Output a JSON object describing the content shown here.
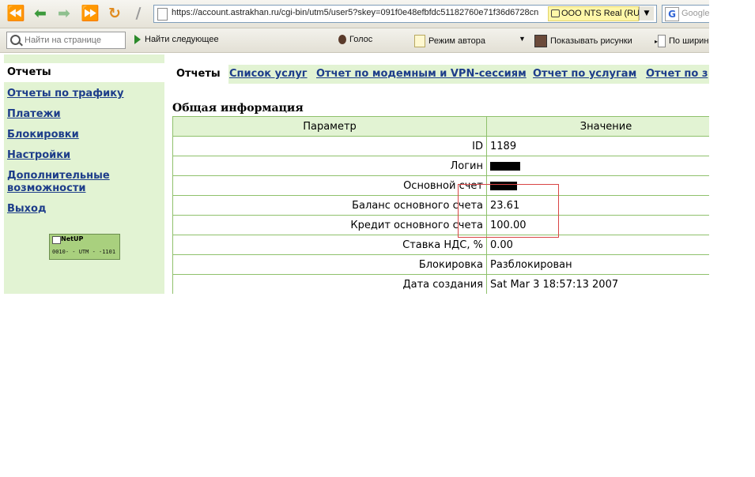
{
  "browser": {
    "url": "https://account.astrakhan.ru/cgi-bin/utm5/user5?skey=091f0e48efbfdc51182760e71f36d6728cn",
    "identity": "OOO NTS Real (RU)",
    "search_placeholder": "Google"
  },
  "findbar": {
    "find_placeholder": "Найти на странице",
    "find_next": "Найти следующее",
    "voice": "Голос",
    "author_mode": "Режим автора",
    "show_images": "Показывать рисунки",
    "by_width": "По ширин"
  },
  "sidebar": {
    "active": "Отчеты",
    "links": [
      "Отчеты по трафику",
      "Платежи",
      "Блокировки",
      "Настройки",
      "Дополнительные возможности",
      "Выход"
    ],
    "logo": {
      "brand": "NetUP",
      "code": "0010- - UTM - -1101"
    }
  },
  "tabs": {
    "active": "Отчеты",
    "links": [
      "Список услуг",
      "Отчет по модемным и VPN-сессиям",
      "Отчет по услугам",
      "Отчет по з"
    ]
  },
  "section": {
    "title": "Общая информация",
    "columns": [
      "Параметр",
      "Значение"
    ],
    "rows": [
      {
        "name": "ID",
        "value": "1189"
      },
      {
        "name": "Логин",
        "value": ""
      },
      {
        "name": "Основной счет",
        "value": ""
      },
      {
        "name": "Баланс основного счета",
        "value": "23.61"
      },
      {
        "name": "Кредит основного счета",
        "value": "100.00"
      },
      {
        "name": "Ставка НДС, %",
        "value": "0.00"
      },
      {
        "name": "Блокировка",
        "value": "Разблокирован"
      },
      {
        "name": "Дата создания",
        "value": "Sat Mar 3 18:57:13 2007"
      }
    ]
  }
}
